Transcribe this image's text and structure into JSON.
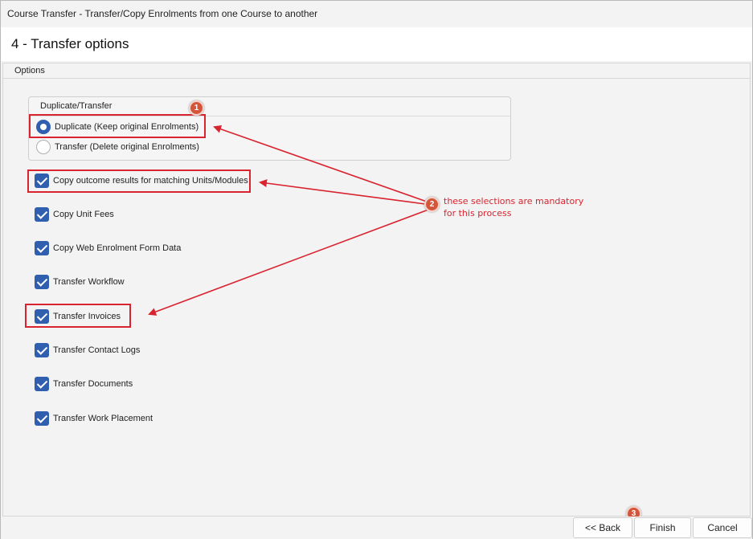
{
  "window": {
    "title": "Course Transfer  - Transfer/Copy Enrolments from one Course to another"
  },
  "header": {
    "title": "4 - Transfer options"
  },
  "tabs": [
    {
      "label": "Options"
    }
  ],
  "duplicate_transfer": {
    "title": "Duplicate/Transfer",
    "options": [
      {
        "label": "Duplicate (Keep original Enrolments)",
        "selected": true
      },
      {
        "label": "Transfer (Delete original Enrolments)",
        "selected": false
      }
    ]
  },
  "checkboxes": [
    {
      "label": "Copy outcome results for matching Units/Modules",
      "checked": true
    },
    {
      "label": "Copy Unit Fees",
      "checked": true
    },
    {
      "label": "Copy Web Enrolment Form Data",
      "checked": true
    },
    {
      "label": "Transfer Workflow",
      "checked": true
    },
    {
      "label": "Transfer Invoices",
      "checked": true
    },
    {
      "label": "Transfer Contact Logs",
      "checked": true
    },
    {
      "label": "Transfer Documents",
      "checked": true
    },
    {
      "label": "Transfer Work Placement",
      "checked": true
    }
  ],
  "annotations": {
    "badges": [
      "1",
      "2",
      "3"
    ],
    "note": "these selections are mandatory for this process",
    "color": "#d9232f"
  },
  "buttons": {
    "back": "<< Back",
    "finish": "Finish",
    "cancel": "Cancel"
  },
  "colors": {
    "accent": "#2f5fae",
    "badge": "#d4553a"
  }
}
